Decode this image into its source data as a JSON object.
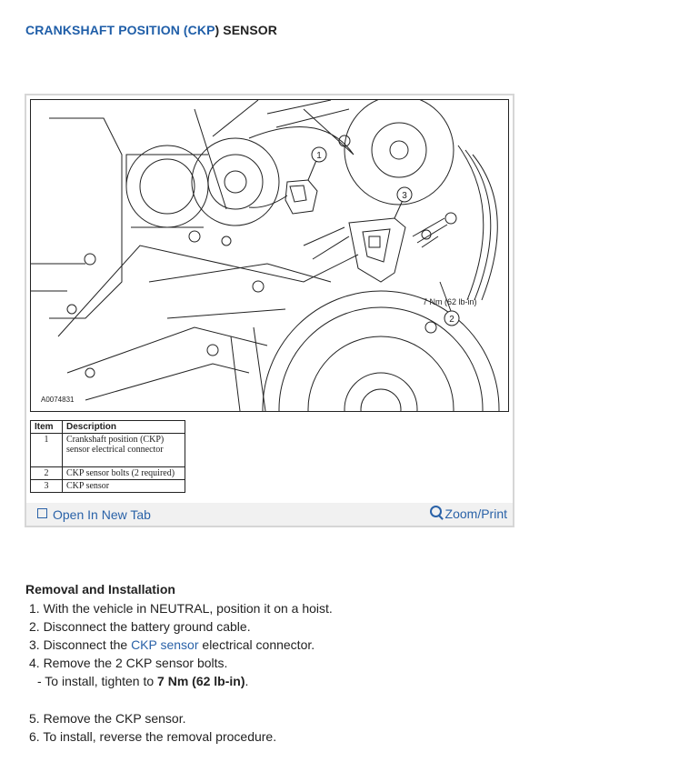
{
  "title": {
    "prefix": "CRANKSHAFT POSITION (",
    "abbr": "CKP",
    "suffix": ") SENSOR"
  },
  "figure": {
    "id_label": "A0074831",
    "torque_callout": "7 Nm (62 lb-in)",
    "callouts": [
      "1",
      "2",
      "3"
    ],
    "legend": {
      "headers": [
        "Item",
        "Description"
      ],
      "rows": [
        {
          "item": "1",
          "desc": "Crankshaft position (CKP) sensor electrical connector"
        },
        {
          "item": "2",
          "desc": "CKP sensor bolts (2 required)"
        },
        {
          "item": "3",
          "desc": "CKP sensor"
        }
      ]
    },
    "open_tab_label": "Open In New Tab",
    "zoom_label": "Zoom/Print"
  },
  "section": {
    "heading": "Removal and Installation",
    "steps": {
      "s1": "1. With the vehicle in NEUTRAL, position it on a hoist.",
      "s2": "2. Disconnect the battery ground cable.",
      "s3_pre": "3. Disconnect the ",
      "s3_link": "CKP sensor",
      "s3_post": " electrical connector.",
      "s4": "4. Remove the 2 CKP sensor bolts.",
      "s4_sub_pre": "- To install, tighten to ",
      "s4_sub_bold": "7 Nm (62 lb-in)",
      "s4_sub_post": ".",
      "s5": "5. Remove the CKP sensor.",
      "s6": "6. To install, reverse the removal procedure."
    }
  },
  "colors": {
    "accent": "#1f5ea8",
    "link": "#2a62a8",
    "footer_bg": "#f1f1f1"
  }
}
